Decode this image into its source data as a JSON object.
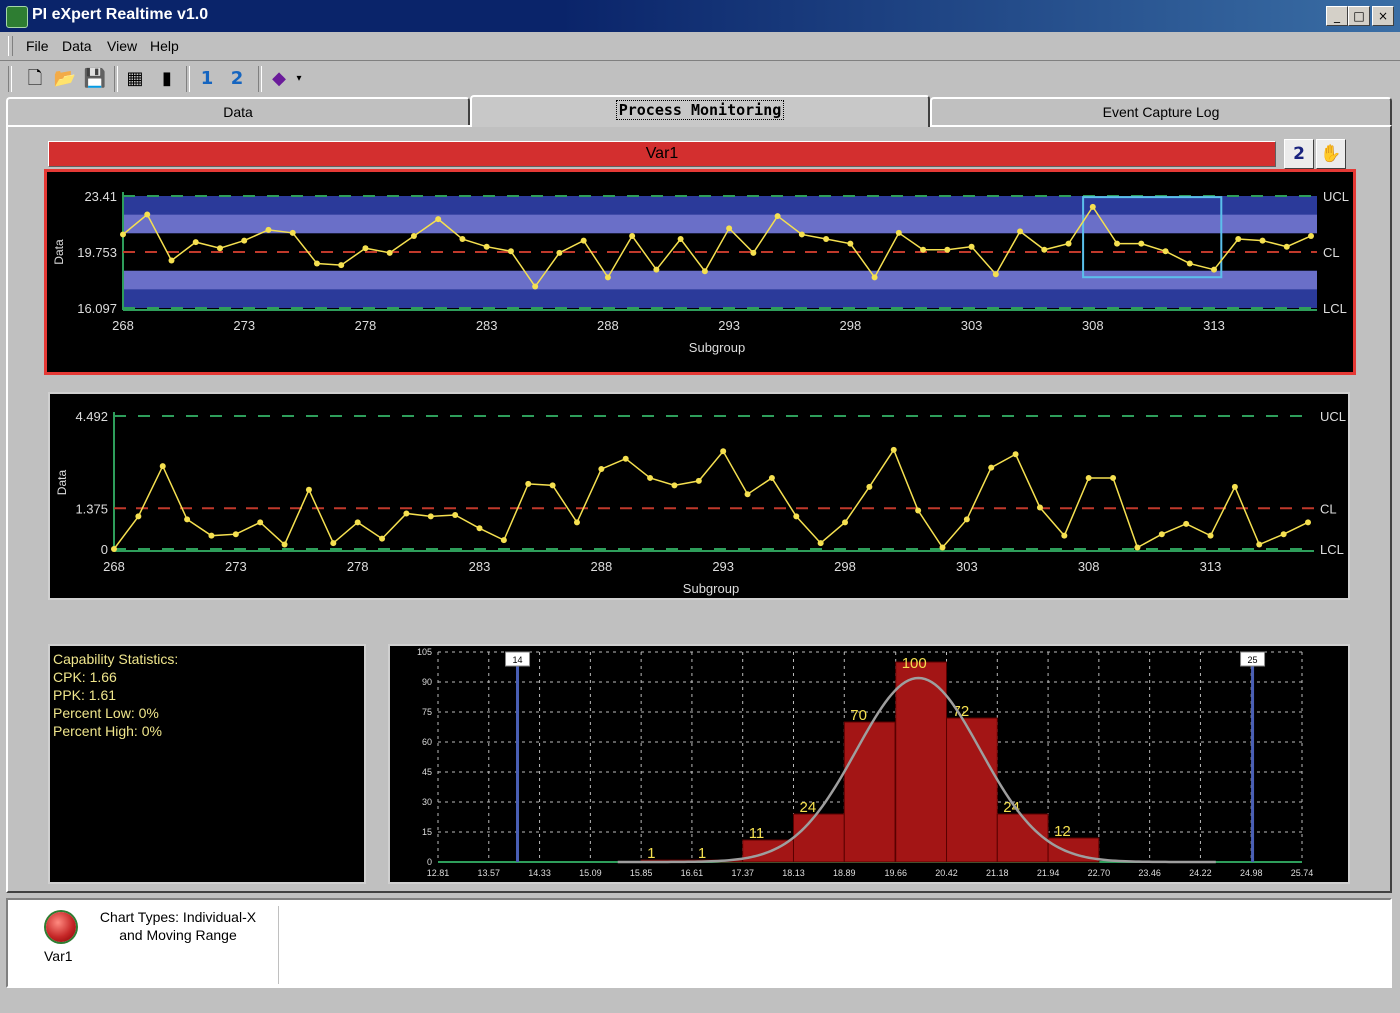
{
  "window": {
    "title": "PI eXpert Realtime v1.0",
    "minimize": "_",
    "maximize": "□",
    "close": "×"
  },
  "menu": [
    {
      "label": "File"
    },
    {
      "label": "Data"
    },
    {
      "label": "View"
    },
    {
      "label": "Help"
    }
  ],
  "toolbar": {
    "new_icon": "new-document-icon",
    "open_icon": "open-folder-icon",
    "save_icon": "save-disk-icon",
    "table_icon": "table-add-icon",
    "page_icon": "page-icon",
    "page1_icon": "page-1-icon",
    "page2_icon": "page-2-icon",
    "book_icon": "book-icon"
  },
  "tabs": [
    {
      "label": "Data"
    },
    {
      "label": "Process Monitoring"
    },
    {
      "label": "Event Capture Log"
    }
  ],
  "var_bar": {
    "label": "Var1"
  },
  "colors": {
    "accent_red": "#d32f2f",
    "band": "#6a6fc8",
    "band_dark": "#2b3a9a",
    "series": "#f5e050",
    "limit_green": "#2e9e5b",
    "cl_red": "#c0392b",
    "hist_bar": "#a31515"
  },
  "chart_data": [
    {
      "type": "line",
      "title": "",
      "xlabel": "Subgroup",
      "ylabel": "Data",
      "x_ticks": [
        268,
        273,
        278,
        283,
        288,
        293,
        298,
        303,
        308,
        313
      ],
      "y_ticks": [
        "23.41",
        "19.753",
        "16.097"
      ],
      "ylim": [
        16.097,
        23.41
      ],
      "xlim": [
        268,
        317
      ],
      "limit_labels": {
        "ucl": "UCL",
        "cl": "CL",
        "lcl": "LCL"
      },
      "limits": {
        "ucl": 23.41,
        "cl": 19.753,
        "lcl": 16.097
      },
      "highlight": {
        "x_from": 307.6,
        "x_to": 313.3
      },
      "x": [
        268,
        269,
        270,
        271,
        272,
        273,
        274,
        275,
        276,
        277,
        278,
        279,
        280,
        281,
        282,
        283,
        284,
        285,
        286,
        287,
        288,
        289,
        290,
        291,
        292,
        293,
        294,
        295,
        296,
        297,
        298,
        299,
        300,
        301,
        302,
        303,
        304,
        305,
        306,
        307,
        308,
        309,
        310,
        311,
        312,
        313,
        314,
        315,
        316,
        317
      ],
      "values": [
        20.9,
        22.2,
        19.2,
        20.4,
        20.0,
        20.5,
        21.2,
        21.0,
        19.0,
        18.9,
        20.0,
        19.7,
        20.8,
        21.9,
        20.6,
        20.1,
        19.8,
        17.5,
        19.7,
        20.5,
        18.1,
        20.8,
        18.6,
        20.6,
        18.5,
        21.3,
        19.7,
        22.1,
        20.9,
        20.6,
        20.3,
        18.1,
        21.0,
        19.9,
        19.9,
        20.1,
        18.3,
        21.1,
        19.9,
        20.3,
        22.7,
        20.3,
        20.3,
        19.8,
        19.0,
        18.6,
        20.6,
        20.5,
        20.1,
        20.8
      ]
    },
    {
      "type": "line",
      "title": "",
      "xlabel": "Subgroup",
      "ylabel": "Data",
      "x_ticks": [
        268,
        273,
        278,
        283,
        288,
        293,
        298,
        303,
        308,
        313
      ],
      "y_ticks": [
        "4.492",
        "1.375",
        "0"
      ],
      "ylim": [
        0,
        4.492
      ],
      "xlim": [
        268,
        317
      ],
      "limit_labels": {
        "ucl": "UCL",
        "cl": "CL",
        "lcl": "LCL"
      },
      "limits": {
        "ucl": 4.492,
        "cl": 1.375,
        "lcl": 0
      },
      "x": [
        268,
        269,
        270,
        271,
        272,
        273,
        274,
        275,
        276,
        277,
        278,
        279,
        280,
        281,
        282,
        283,
        284,
        285,
        286,
        287,
        288,
        289,
        290,
        291,
        292,
        293,
        294,
        295,
        296,
        297,
        298,
        299,
        300,
        301,
        302,
        303,
        304,
        305,
        306,
        307,
        308,
        309,
        310,
        311,
        312,
        313,
        314,
        315,
        316,
        317
      ],
      "values": [
        0.0,
        1.1,
        2.8,
        1.0,
        0.45,
        0.5,
        0.9,
        0.15,
        2.0,
        0.2,
        0.9,
        0.35,
        1.2,
        1.1,
        1.15,
        0.7,
        0.3,
        2.2,
        2.15,
        0.9,
        2.7,
        3.05,
        2.4,
        2.15,
        2.3,
        3.3,
        1.85,
        2.4,
        1.1,
        0.2,
        0.9,
        2.1,
        3.35,
        1.3,
        0.05,
        1.0,
        2.75,
        3.2,
        1.4,
        0.45,
        2.4,
        2.4,
        0.05,
        0.5,
        0.85,
        0.45,
        2.1,
        0.15,
        0.5,
        0.9
      ]
    },
    {
      "type": "bar",
      "title": "",
      "xlabel": "",
      "ylabel": "",
      "categories": [
        "15.85",
        "16.61",
        "17.37",
        "18.13",
        "18.89",
        "19.66",
        "20.42",
        "21.18",
        "21.94"
      ],
      "values": [
        1,
        1,
        11,
        24,
        70,
        100,
        72,
        24,
        12
      ],
      "data_labels": [
        "1",
        "1",
        "11",
        "24",
        "70",
        "100",
        "72",
        "24",
        "12"
      ],
      "x_ticks": [
        "12.81",
        "13.57",
        "14.33",
        "15.09",
        "15.85",
        "16.61",
        "17.37",
        "18.13",
        "18.89",
        "19.66",
        "20.42",
        "21.18",
        "21.94",
        "22.70",
        "23.46",
        "24.22",
        "24.98",
        "25.74"
      ],
      "y_ticks": [
        "105",
        "90",
        "75",
        "60",
        "45",
        "30",
        "15",
        "0"
      ],
      "xlim": [
        12.81,
        25.74
      ],
      "ylim": [
        0,
        105
      ],
      "spec_lines": [
        {
          "x": 14.0,
          "label": "14"
        },
        {
          "x": 25.0,
          "label": "25"
        }
      ],
      "fit_curve": {
        "type": "normal",
        "mean": 20.0,
        "sd": 0.93,
        "peak": 92
      },
      "grid": true
    }
  ],
  "stats": {
    "header": "Capability Statistics:",
    "cpk": "CPK: 1.66",
    "ppk": "PPK: 1.61",
    "low": "Percent Low: 0%",
    "high": "Percent High: 0%"
  },
  "bottom": {
    "var_name": "Var1",
    "chart_types_line1": "Chart Types: Individual-X",
    "chart_types_line2": "and Moving Range"
  }
}
